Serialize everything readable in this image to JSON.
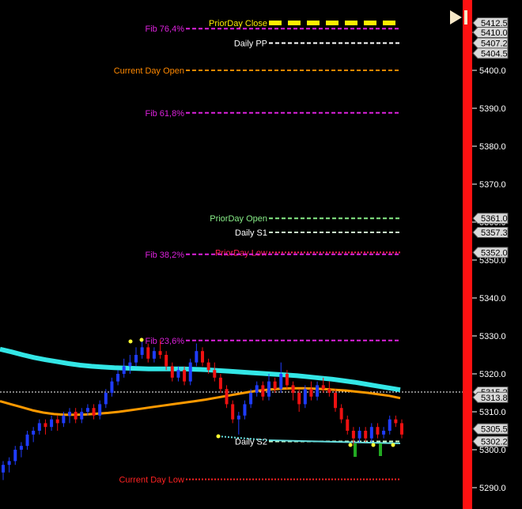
{
  "chart_data": {
    "type": "candlestick",
    "y_axis": {
      "ticks": [
        5290.0,
        5300.0,
        5310.0,
        5320.0,
        5330.0,
        5340.0,
        5350.0,
        5360.0,
        5370.0,
        5380.0,
        5390.0,
        5400.0,
        5410.0
      ],
      "range": [
        5285,
        5413.5
      ],
      "position": "right"
    },
    "levels": [
      {
        "label": "PriorDay Close",
        "value": 5412.5,
        "color": "#ffee00",
        "style": "thick-dash",
        "label_color": "#ffee00"
      },
      {
        "label": "Fib 76,4%",
        "value": 5411.0,
        "color": "#dd22dd",
        "style": "dash",
        "label_color": "#dd22dd"
      },
      {
        "label": "Daily PP",
        "value": 5407.2,
        "color": "#ffffff",
        "style": "dash",
        "label_color": "#ffffff"
      },
      {
        "label": "Current Day Open",
        "value": 5400.0,
        "color": "#ff8800",
        "style": "dash",
        "label_color": "#ff8800"
      },
      {
        "label": "Fib 61,8%",
        "value": 5388.8,
        "color": "#dd22dd",
        "style": "dash",
        "label_color": "#dd22dd"
      },
      {
        "label": "PriorDay Open",
        "value": 5361.0,
        "color": "#88ee88",
        "style": "dash",
        "label_color": "#88ee88"
      },
      {
        "label": "Daily S1",
        "value": 5357.3,
        "color": "#ccffcc",
        "style": "dash",
        "label_color": "#ffffff"
      },
      {
        "label": "PriorDay Low",
        "value": 5352.0,
        "color": "#ff2255",
        "style": "dot",
        "label_color": "#ff2255"
      },
      {
        "label": "Fib 38,2%",
        "value": 5351.5,
        "color": "#dd22dd",
        "style": "dash",
        "label_color": "#dd22dd"
      },
      {
        "label": "Fib 23,6%",
        "value": 5328.8,
        "color": "#dd22dd",
        "style": "dash",
        "label_color": "#dd22dd"
      },
      {
        "label": "Daily S2",
        "value": 5302.2,
        "color": "#ccffcc",
        "style": "dash",
        "label_color": "#ffffff"
      },
      {
        "label": "Current Day Low",
        "value": 5292.2,
        "color": "#ff2222",
        "style": "dot",
        "label_color": "#ff2222"
      }
    ],
    "price_tags": [
      "5412.5",
      "5410.0",
      "5407.2",
      "5404.5",
      "5361.0",
      "5357.3",
      "5352.0",
      "5315.2",
      "5313.8",
      "5305.5",
      "5302.2"
    ],
    "current_price": 5315.2,
    "candles": [
      [
        5294,
        5297,
        5292,
        5296
      ],
      [
        5296,
        5298,
        5294,
        5297
      ],
      [
        5297,
        5301,
        5296,
        5300
      ],
      [
        5300,
        5302,
        5298,
        5301
      ],
      [
        5301,
        5305,
        5300,
        5304
      ],
      [
        5304,
        5306,
        5302,
        5305
      ],
      [
        5305,
        5308,
        5304,
        5307
      ],
      [
        5307,
        5308,
        5304,
        5306
      ],
      [
        5306,
        5309,
        5305,
        5308
      ],
      [
        5308,
        5309,
        5305,
        5307
      ],
      [
        5307,
        5310,
        5306,
        5309
      ],
      [
        5309,
        5311,
        5307,
        5310
      ],
      [
        5310,
        5311,
        5307,
        5308
      ],
      [
        5308,
        5311,
        5307,
        5310
      ],
      [
        5310,
        5312,
        5309,
        5311
      ],
      [
        5311,
        5312,
        5308,
        5309
      ],
      [
        5309,
        5313,
        5308,
        5312
      ],
      [
        5312,
        5316,
        5311,
        5315
      ],
      [
        5315,
        5319,
        5314,
        5318
      ],
      [
        5318,
        5321,
        5317,
        5320
      ],
      [
        5320,
        5324,
        5319,
        5322
      ],
      [
        5322,
        5325,
        5320,
        5323
      ],
      [
        5323,
        5327,
        5322,
        5325
      ],
      [
        5325,
        5329,
        5324,
        5327
      ],
      [
        5327,
        5328,
        5323,
        5324
      ],
      [
        5324,
        5327,
        5323,
        5326
      ],
      [
        5326,
        5329,
        5324,
        5325
      ],
      [
        5325,
        5326,
        5321,
        5322
      ],
      [
        5322,
        5323,
        5318,
        5319
      ],
      [
        5319,
        5322,
        5318,
        5321
      ],
      [
        5321,
        5322,
        5317,
        5318
      ],
      [
        5318,
        5324,
        5317,
        5323
      ],
      [
        5323,
        5328,
        5322,
        5326
      ],
      [
        5326,
        5327,
        5322,
        5323
      ],
      [
        5323,
        5324,
        5320,
        5321
      ],
      [
        5321,
        5323,
        5318,
        5319
      ],
      [
        5319,
        5320,
        5315,
        5316
      ],
      [
        5316,
        5317,
        5311,
        5312
      ],
      [
        5312,
        5313,
        5307,
        5308
      ],
      [
        5308,
        5310,
        5304,
        5309
      ],
      [
        5309,
        5313,
        5308,
        5312
      ],
      [
        5312,
        5316,
        5311,
        5315
      ],
      [
        5315,
        5318,
        5314,
        5317
      ],
      [
        5317,
        5318,
        5313,
        5314
      ],
      [
        5314,
        5320,
        5313,
        5318
      ],
      [
        5318,
        5319,
        5315,
        5316
      ],
      [
        5316,
        5323,
        5315,
        5320
      ],
      [
        5320,
        5321,
        5316,
        5317
      ],
      [
        5317,
        5318,
        5313,
        5315
      ],
      [
        5315,
        5316,
        5310,
        5312
      ],
      [
        5312,
        5317,
        5311,
        5316
      ],
      [
        5316,
        5318,
        5313,
        5314
      ],
      [
        5314,
        5318,
        5313,
        5317
      ],
      [
        5317,
        5319,
        5315,
        5316
      ],
      [
        5316,
        5318,
        5314,
        5315
      ],
      [
        5315,
        5316,
        5310,
        5311
      ],
      [
        5311,
        5312,
        5307,
        5308
      ],
      [
        5308,
        5309,
        5304,
        5305
      ],
      [
        5305,
        5306,
        5301,
        5303
      ],
      [
        5303,
        5306,
        5302,
        5305
      ],
      [
        5305,
        5306,
        5302,
        5303
      ],
      [
        5303,
        5307,
        5302,
        5306
      ],
      [
        5306,
        5307,
        5303,
        5304
      ],
      [
        5304,
        5306,
        5303,
        5305
      ],
      [
        5305,
        5309,
        5304,
        5308
      ],
      [
        5308,
        5309,
        5306,
        5307
      ],
      [
        5307,
        5308,
        5303,
        5304
      ]
    ],
    "series": [
      {
        "name": "EMA fast",
        "color": "#33e6e6",
        "values": [
          5326.5,
          5325.8,
          5325.0,
          5324.3,
          5323.7,
          5323.2,
          5322.7,
          5322.3,
          5322.0,
          5321.8,
          5321.6,
          5321.5,
          5321.4,
          5321.3,
          5321.3,
          5321.3,
          5321.3,
          5321.2,
          5321.1,
          5320.9,
          5320.7,
          5320.5,
          5320.3,
          5320.1,
          5319.9,
          5319.7,
          5319.5,
          5319.2,
          5318.9,
          5318.6,
          5318.2,
          5317.8,
          5317.3,
          5316.8,
          5316.3,
          5315.8
        ]
      },
      {
        "name": "EMA slow",
        "color": "#ff9900",
        "values": [
          5312.8,
          5312.0,
          5311.2,
          5310.4,
          5309.8,
          5309.4,
          5309.2,
          5309.2,
          5309.3,
          5309.5,
          5309.7,
          5310.0,
          5310.4,
          5310.8,
          5311.2,
          5311.6,
          5312.0,
          5312.4,
          5312.8,
          5313.2,
          5313.7,
          5314.2,
          5314.7,
          5315.2,
          5315.6,
          5315.9,
          5316.1,
          5316.2,
          5316.2,
          5316.1,
          5316.0,
          5315.8,
          5315.6,
          5315.3,
          5315.0,
          5314.6,
          5314.2,
          5313.6
        ]
      }
    ],
    "grid": false
  }
}
